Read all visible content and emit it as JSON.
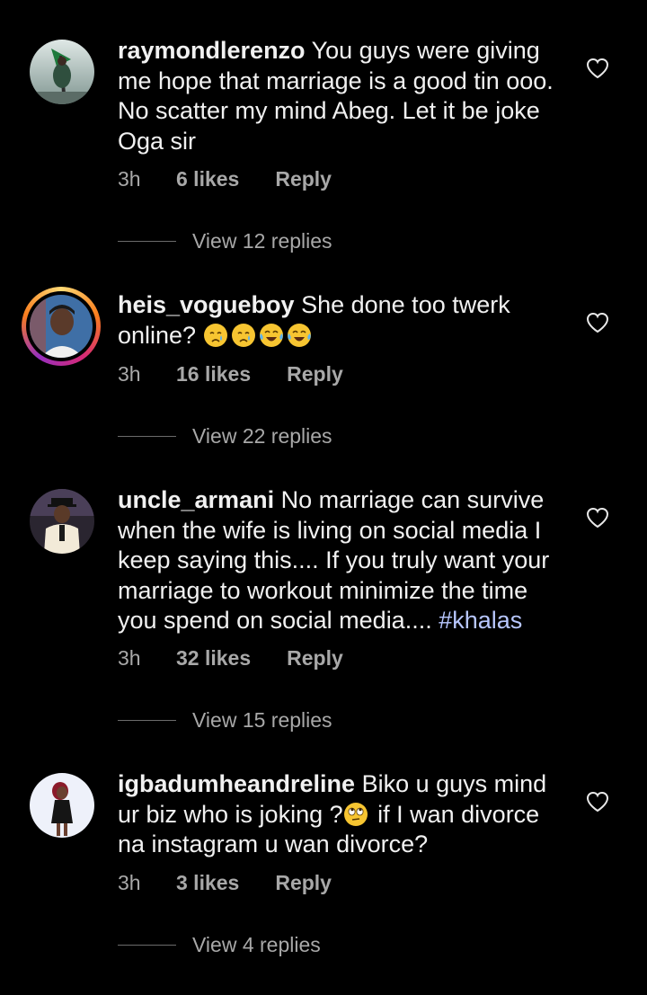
{
  "comments": [
    {
      "username": "raymondlerenzo",
      "text": "You guys were giving me hope that marriage is a good tin ooo. No scatter my mind Abeg. Let it be joke Oga sir",
      "time": "3h",
      "likes": "6 likes",
      "reply": "Reply",
      "view_replies": "View 12 replies"
    },
    {
      "username": "heis_vogueboy",
      "text": "She done too twerk online?",
      "emojis": [
        "crying-face",
        "crying-face",
        "tears-of-joy",
        "tears-of-joy"
      ],
      "time": "3h",
      "likes": "16 likes",
      "reply": "Reply",
      "view_replies": "View 22 replies"
    },
    {
      "username": "uncle_armani",
      "text": "No marriage can survive when the wife is living on social media I keep saying this.... If you truly want your marriage to workout minimize the time you spend on social media....",
      "hashtag": "#khalas",
      "time": "3h",
      "likes": "32 likes",
      "reply": "Reply",
      "view_replies": "View 15 replies"
    },
    {
      "username": "igbadumheandreline",
      "text_before": "Biko u guys mind ur biz who is joking ?",
      "emoji": "eye-roll",
      "text_after": " if I wan divorce na instagram u wan divorce?",
      "time": "3h",
      "likes": "3 likes",
      "reply": "Reply",
      "view_replies": "View 4 replies"
    }
  ],
  "colors": {
    "background": "#000000",
    "text": "#f1f1f1",
    "secondary": "#a8a8a8",
    "hashtag": "#b8c7ff"
  }
}
